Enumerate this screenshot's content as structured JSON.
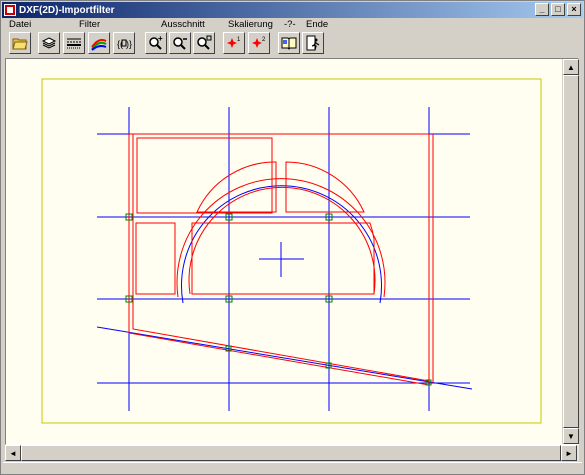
{
  "window": {
    "title": "DXF(2D)-Importfilter",
    "controls": [
      "_",
      "□",
      "×"
    ]
  },
  "menu": [
    "Datei",
    "Filter",
    "Ausschnitt",
    "Skalierung",
    "-?-",
    "Ende"
  ],
  "toolbar": {
    "buttons": [
      "open-folder-icon",
      "layers-icon",
      "linetype-icon",
      "colors-icon",
      "attributes-icon",
      "zoom-in-icon",
      "zoom-out-icon",
      "zoom-window-icon",
      "scale-1-icon",
      "scale-2-icon",
      "help-book-icon",
      "exit-icon"
    ]
  },
  "colors": {
    "paper": "#fffef0",
    "border": "#c8c800",
    "axis": "#0000ff",
    "wall": "#ff0000",
    "node": "#008000"
  }
}
